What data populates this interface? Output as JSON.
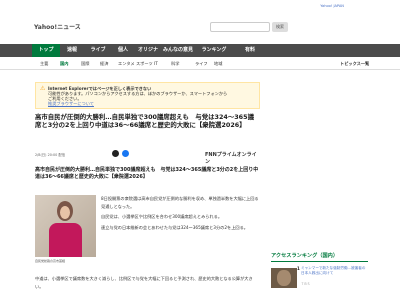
{
  "header": {
    "logo": "Yahoo!ニュース",
    "top_links": "Yahoo! JAPAN",
    "search_button": "検索"
  },
  "global_nav": [
    "トップ",
    "速報",
    "ライブ",
    "個人",
    "オリジナル",
    "みんなの意見",
    "ランキング",
    "有料"
  ],
  "sub_nav": [
    "主要",
    "国内",
    "国際",
    "経済",
    "エンタメ",
    "スポーツ",
    "IT",
    "科学",
    "ライフ",
    "地域",
    "",
    "",
    "トピックス一覧"
  ],
  "notice": {
    "title": "Internet Explorerではページを正しく表示できない",
    "body": "可能性があります。パソコンからアクセスする方は、ほかのブラウザーか、スマートフォンから",
    "body2": "ご利用ください。",
    "link": "推奨ブラウザーについて"
  },
  "article": {
    "headline": "高市自民が圧倒的大勝利…自民単独で300議席超えも　与党は324～365議席と3分の2を上回り中道は36～66議席と歴史的大敗に【衆院選2026】",
    "date": "2/8(日) 20:00 配信",
    "source_logo": "FNNプライムオンライン",
    "subhead": "高市自民が圧倒的大勝利…自民単独で300議席超えも　与党は324～365議席と3分の2を上回り中道は36～66議席と歴史的大敗に【衆院選2026】",
    "photo_caption": "自民党総裁の高市首相",
    "paragraphs": [
      "8日投開票の衆院選は高市自民党が圧倒的な勝利を収め、単独過半数を大幅に上回る見通しとなった。",
      "自民党は、小選挙区や比例区を合わせ300議席超えとみられる。",
      "連立与党の日本維新の会とあわせた与党は324～365議席と3分の2を上回る。",
      "一方、中道改革連合は36～66議席にとどまる見込み。"
    ],
    "bottom": "中道は、小選挙区で議席数を大きく減らし、比例区で与党を大幅に下回ると予測され、歴史的大敗となる公算が大きい。"
  },
  "ranking": {
    "title": "アクセスランキング（国内）",
    "rank_no": "1",
    "item": "ミャンマーで新たな強制労働…被害者の日本人救出に向けて",
    "item_meta": "ＴＢＳ"
  }
}
